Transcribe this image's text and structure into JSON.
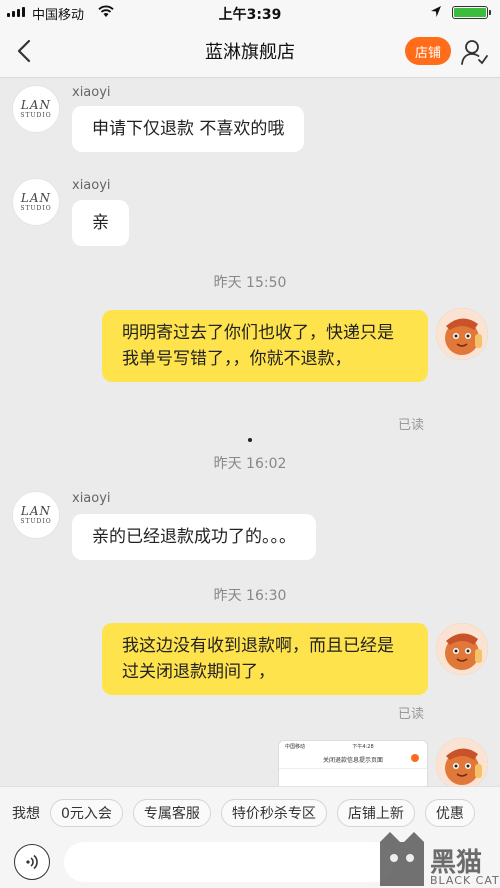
{
  "status_bar": {
    "carrier": "中国移动",
    "time": "上午3:39"
  },
  "nav": {
    "title": "蓝淋旗舰店",
    "shop_button": "店铺"
  },
  "store_avatar": {
    "logo_main": "LAN",
    "logo_sub": "STUDIO"
  },
  "messages": [
    {
      "sender": "xiaoyi",
      "text": "申请下仅退款  不喜欢的哦"
    },
    {
      "sender": "xiaoyi",
      "text": "亲"
    },
    {
      "timestamp": "昨天 15:50"
    },
    {
      "text": "明明寄过去了你们也收了，快递只是我单号写错了，，你就不退款，",
      "read": "已读"
    },
    {
      "timestamp": "昨天 16:02"
    },
    {
      "sender": "xiaoyi",
      "text": "亲的已经退款成功了的。。。"
    },
    {
      "timestamp": "昨天 16:30"
    },
    {
      "text": "我这边没有收到退款啊，而且已经是过关闭退款期间了，",
      "read": "已读"
    }
  ],
  "screenshot_card": {
    "carrier": "中国移动",
    "time": "下午4:28",
    "title": "关闭退款信息提示页面"
  },
  "quick_bar": {
    "label": "我想",
    "chips": [
      "0元入会",
      "专属客服",
      "特价秒杀专区",
      "店铺上新",
      "优惠"
    ]
  },
  "input": {
    "placeholder": ""
  },
  "watermark": {
    "text_cn": "黑猫",
    "text_en": "BLACK CAT"
  },
  "colors": {
    "accent": "#ff6c1a",
    "bubble_self": "#ffe34d",
    "bubble_other": "#ffffff",
    "background": "#ebebeb"
  }
}
